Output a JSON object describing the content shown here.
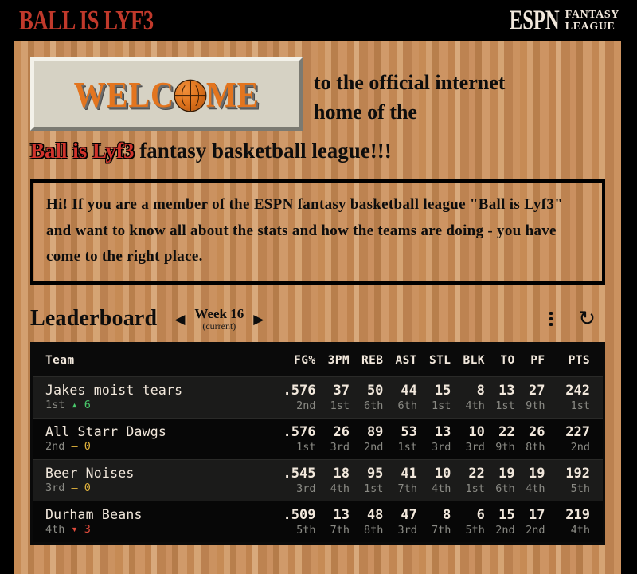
{
  "header": {
    "site_title": "BALL IS LYF3",
    "espn_word": "ESPN",
    "espn_sub_line1": "FANTASY",
    "espn_sub_line2": "LEAGUE"
  },
  "hero": {
    "welcome_word": "WELC",
    "welcome_word_end": "ME",
    "welcome_alt": "WELCOME",
    "line1": "to the official internet",
    "line2": "home of the",
    "tagline_brand": "Ball is Lyf3",
    "tagline_rest": " fantasy basketball league!!!"
  },
  "infobox": {
    "text": "Hi! If you are a member of the ESPN fantasy basketball league \"Ball is Lyf3\" and want to know all about the stats and how the teams are doing - you have come to the right place."
  },
  "leaderboard": {
    "title": "Leaderboard",
    "prev_arrow": "◀",
    "next_arrow": "▶",
    "week_label": "Week 16",
    "week_status": "(current)",
    "menu_icon": "kebab-menu-icon",
    "refresh_icon": "↻",
    "columns": [
      "Team",
      "FG%",
      "3PM",
      "REB",
      "AST",
      "STL",
      "BLK",
      "TO",
      "PF",
      "PTS"
    ],
    "rows": [
      {
        "team": "Jakes moist tears",
        "place": "1st",
        "move_dir": "up",
        "move_arrow": "▴",
        "move_value": "6",
        "stats": [
          {
            "value": ".576",
            "rank": "2nd"
          },
          {
            "value": "37",
            "rank": "1st"
          },
          {
            "value": "50",
            "rank": "6th"
          },
          {
            "value": "44",
            "rank": "6th"
          },
          {
            "value": "15",
            "rank": "1st"
          },
          {
            "value": "8",
            "rank": "4th"
          },
          {
            "value": "13",
            "rank": "1st"
          },
          {
            "value": "27",
            "rank": "9th"
          },
          {
            "value": "242",
            "rank": "1st"
          }
        ]
      },
      {
        "team": "All Starr Dawgs",
        "place": "2nd",
        "move_dir": "flat",
        "move_arrow": "–",
        "move_value": "0",
        "stats": [
          {
            "value": ".576",
            "rank": "1st"
          },
          {
            "value": "26",
            "rank": "3rd"
          },
          {
            "value": "89",
            "rank": "2nd"
          },
          {
            "value": "53",
            "rank": "1st"
          },
          {
            "value": "13",
            "rank": "3rd"
          },
          {
            "value": "10",
            "rank": "3rd"
          },
          {
            "value": "22",
            "rank": "9th"
          },
          {
            "value": "26",
            "rank": "8th"
          },
          {
            "value": "227",
            "rank": "2nd"
          }
        ]
      },
      {
        "team": "Beer Noises",
        "place": "3rd",
        "move_dir": "flat",
        "move_arrow": "–",
        "move_value": "0",
        "stats": [
          {
            "value": ".545",
            "rank": "3rd"
          },
          {
            "value": "18",
            "rank": "4th"
          },
          {
            "value": "95",
            "rank": "1st"
          },
          {
            "value": "41",
            "rank": "7th"
          },
          {
            "value": "10",
            "rank": "4th"
          },
          {
            "value": "22",
            "rank": "1st"
          },
          {
            "value": "19",
            "rank": "6th"
          },
          {
            "value": "19",
            "rank": "4th"
          },
          {
            "value": "192",
            "rank": "5th"
          }
        ]
      },
      {
        "team": "Durham Beans",
        "place": "4th",
        "move_dir": "down",
        "move_arrow": "▾",
        "move_value": "3",
        "stats": [
          {
            "value": ".509",
            "rank": "5th"
          },
          {
            "value": "13",
            "rank": "7th"
          },
          {
            "value": "48",
            "rank": "8th"
          },
          {
            "value": "47",
            "rank": "3rd"
          },
          {
            "value": "8",
            "rank": "7th"
          },
          {
            "value": "6",
            "rank": "5th"
          },
          {
            "value": "15",
            "rank": "2nd"
          },
          {
            "value": "17",
            "rank": "2nd"
          },
          {
            "value": "219",
            "rank": "4th"
          }
        ]
      }
    ]
  },
  "colors": {
    "brand_red": "#c0392b",
    "court_wood": "#c98d57",
    "table_bg": "#0a0a0a",
    "cream": "#f2e8dc",
    "move_up": "#49c96b",
    "move_down": "#e04b3c",
    "move_flat": "#e0b23c"
  }
}
